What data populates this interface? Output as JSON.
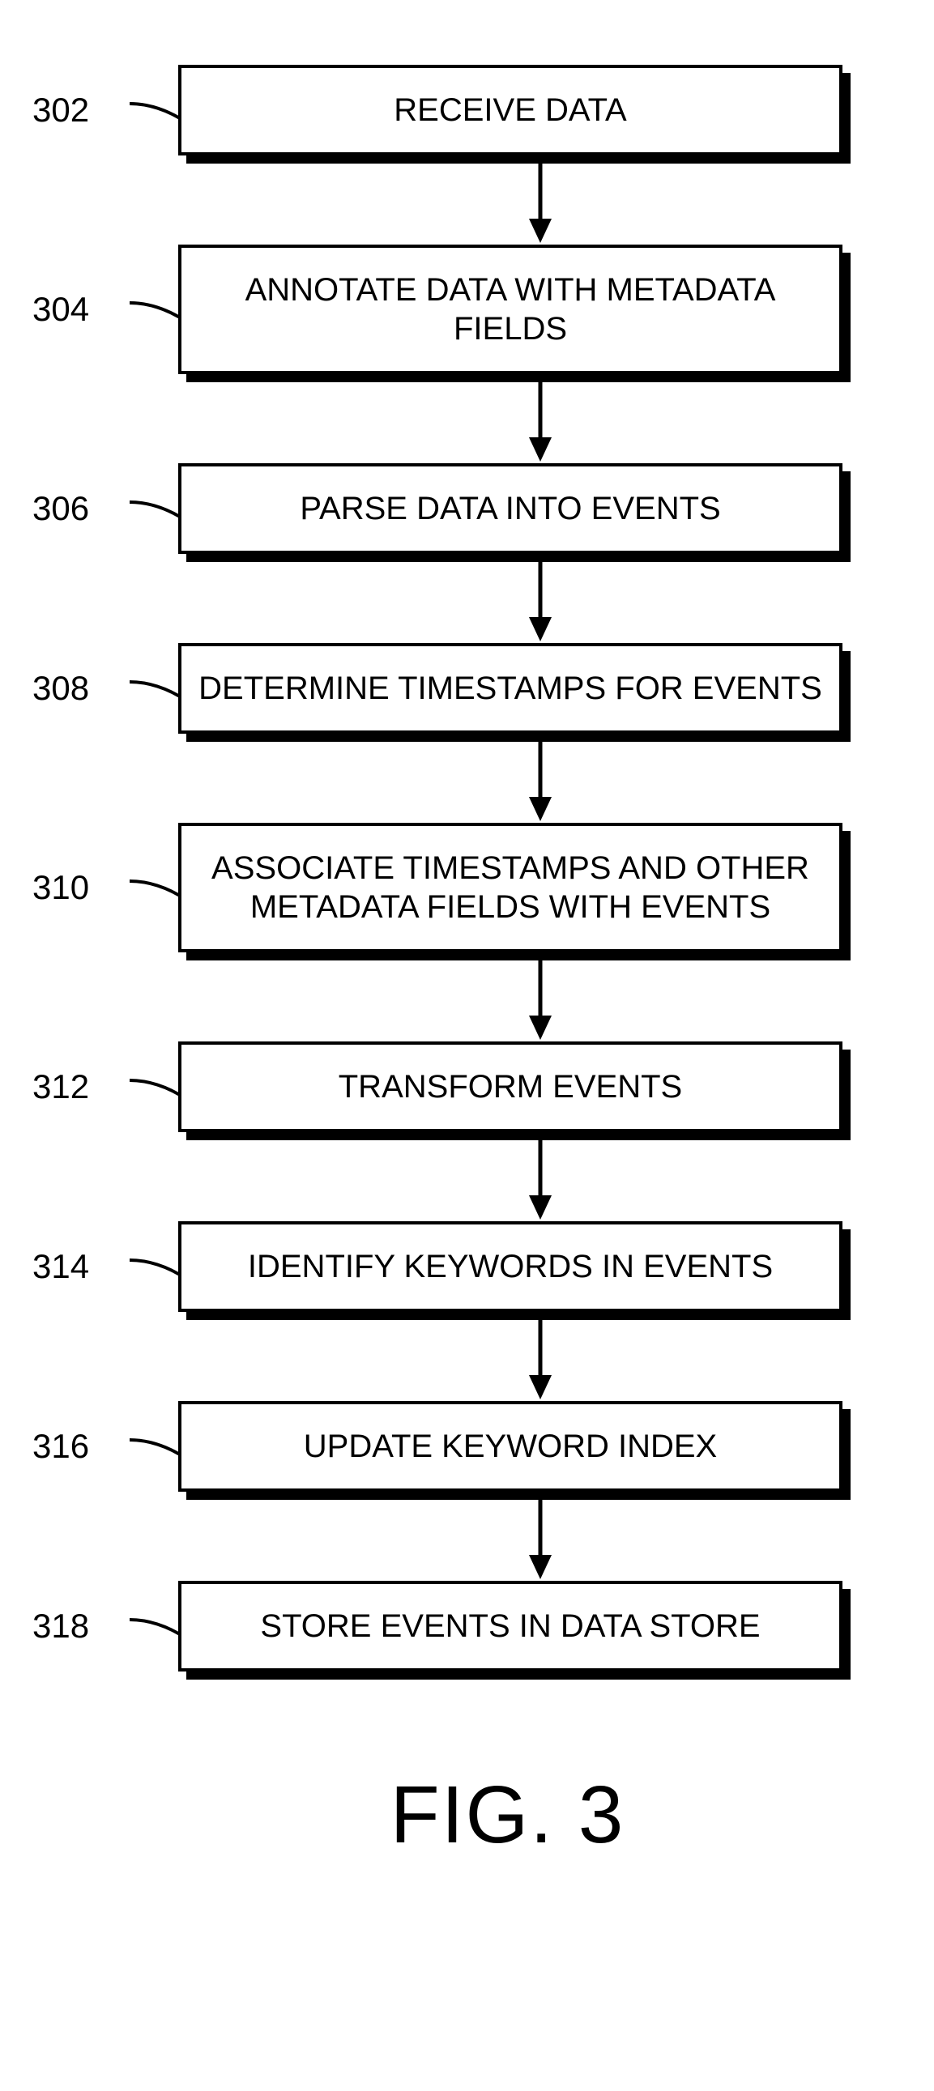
{
  "chart_data": {
    "type": "flowchart",
    "title": "FIG. 3",
    "steps": [
      {
        "id": "302",
        "label": "RECEIVE DATA"
      },
      {
        "id": "304",
        "label": "ANNOTATE DATA WITH METADATA FIELDS"
      },
      {
        "id": "306",
        "label": "PARSE DATA INTO EVENTS"
      },
      {
        "id": "308",
        "label": "DETERMINE TIMESTAMPS FOR EVENTS"
      },
      {
        "id": "310",
        "label": "ASSOCIATE TIMESTAMPS AND OTHER METADATA FIELDS WITH EVENTS"
      },
      {
        "id": "312",
        "label": "TRANSFORM EVENTS"
      },
      {
        "id": "314",
        "label": "IDENTIFY KEYWORDS IN EVENTS"
      },
      {
        "id": "316",
        "label": "UPDATE KEYWORD INDEX"
      },
      {
        "id": "318",
        "label": "STORE EVENTS IN DATA STORE"
      }
    ]
  }
}
